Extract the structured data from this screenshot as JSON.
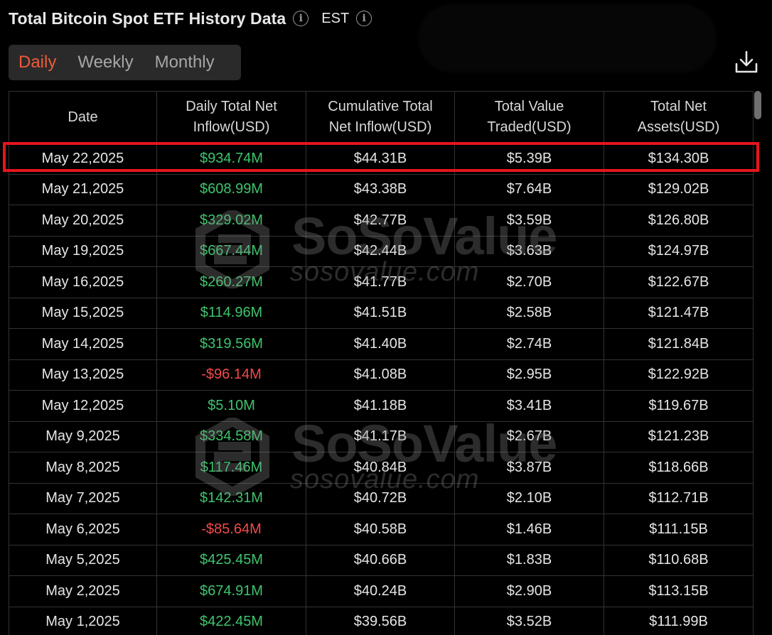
{
  "header": {
    "title": "Total Bitcoin Spot ETF History Data",
    "timezone": "EST",
    "info_icon": "info-icon"
  },
  "tabs": [
    {
      "label": "Daily",
      "active": true
    },
    {
      "label": "Weekly",
      "active": false
    },
    {
      "label": "Monthly",
      "active": false
    }
  ],
  "toolbar": {
    "download_icon": "download-icon"
  },
  "colors": {
    "accent": "#ef5a3a",
    "positive": "#3ec46d",
    "negative": "#f04a4a",
    "highlight": "#e8141b"
  },
  "watermark": {
    "name": "SoSoValue",
    "url": "sosovalue.com"
  },
  "table": {
    "columns": [
      {
        "line1": "Date",
        "line2": ""
      },
      {
        "line1": "Daily Total Net",
        "line2": "Inflow(USD)"
      },
      {
        "line1": "Cumulative Total",
        "line2": "Net Inflow(USD)"
      },
      {
        "line1": "Total Value",
        "line2": "Traded(USD)"
      },
      {
        "line1": "Total Net",
        "line2": "Assets(USD)"
      }
    ],
    "rows": [
      {
        "date": "May 22,2025",
        "inflow": "$934.74M",
        "sign": "pos",
        "cumulative": "$44.31B",
        "traded": "$5.39B",
        "assets": "$134.30B",
        "highlighted": true
      },
      {
        "date": "May 21,2025",
        "inflow": "$608.99M",
        "sign": "pos",
        "cumulative": "$43.38B",
        "traded": "$7.64B",
        "assets": "$129.02B"
      },
      {
        "date": "May 20,2025",
        "inflow": "$329.02M",
        "sign": "pos",
        "cumulative": "$42.77B",
        "traded": "$3.59B",
        "assets": "$126.80B"
      },
      {
        "date": "May 19,2025",
        "inflow": "$667.44M",
        "sign": "pos",
        "cumulative": "$42.44B",
        "traded": "$3.63B",
        "assets": "$124.97B"
      },
      {
        "date": "May 16,2025",
        "inflow": "$260.27M",
        "sign": "pos",
        "cumulative": "$41.77B",
        "traded": "$2.70B",
        "assets": "$122.67B"
      },
      {
        "date": "May 15,2025",
        "inflow": "$114.96M",
        "sign": "pos",
        "cumulative": "$41.51B",
        "traded": "$2.58B",
        "assets": "$121.47B"
      },
      {
        "date": "May 14,2025",
        "inflow": "$319.56M",
        "sign": "pos",
        "cumulative": "$41.40B",
        "traded": "$2.74B",
        "assets": "$121.84B"
      },
      {
        "date": "May 13,2025",
        "inflow": "-$96.14M",
        "sign": "neg",
        "cumulative": "$41.08B",
        "traded": "$2.95B",
        "assets": "$122.92B"
      },
      {
        "date": "May 12,2025",
        "inflow": "$5.10M",
        "sign": "pos",
        "cumulative": "$41.18B",
        "traded": "$3.41B",
        "assets": "$119.67B"
      },
      {
        "date": "May 9,2025",
        "inflow": "$334.58M",
        "sign": "pos",
        "cumulative": "$41.17B",
        "traded": "$2.67B",
        "assets": "$121.23B"
      },
      {
        "date": "May 8,2025",
        "inflow": "$117.46M",
        "sign": "pos",
        "cumulative": "$40.84B",
        "traded": "$3.87B",
        "assets": "$118.66B"
      },
      {
        "date": "May 7,2025",
        "inflow": "$142.31M",
        "sign": "pos",
        "cumulative": "$40.72B",
        "traded": "$2.10B",
        "assets": "$112.71B"
      },
      {
        "date": "May 6,2025",
        "inflow": "-$85.64M",
        "sign": "neg",
        "cumulative": "$40.58B",
        "traded": "$1.46B",
        "assets": "$111.15B"
      },
      {
        "date": "May 5,2025",
        "inflow": "$425.45M",
        "sign": "pos",
        "cumulative": "$40.66B",
        "traded": "$1.83B",
        "assets": "$110.68B"
      },
      {
        "date": "May 2,2025",
        "inflow": "$674.91M",
        "sign": "pos",
        "cumulative": "$40.24B",
        "traded": "$2.90B",
        "assets": "$113.15B"
      },
      {
        "date": "May 1,2025",
        "inflow": "$422.45M",
        "sign": "pos",
        "cumulative": "$39.56B",
        "traded": "$3.52B",
        "assets": "$111.99B"
      }
    ]
  }
}
